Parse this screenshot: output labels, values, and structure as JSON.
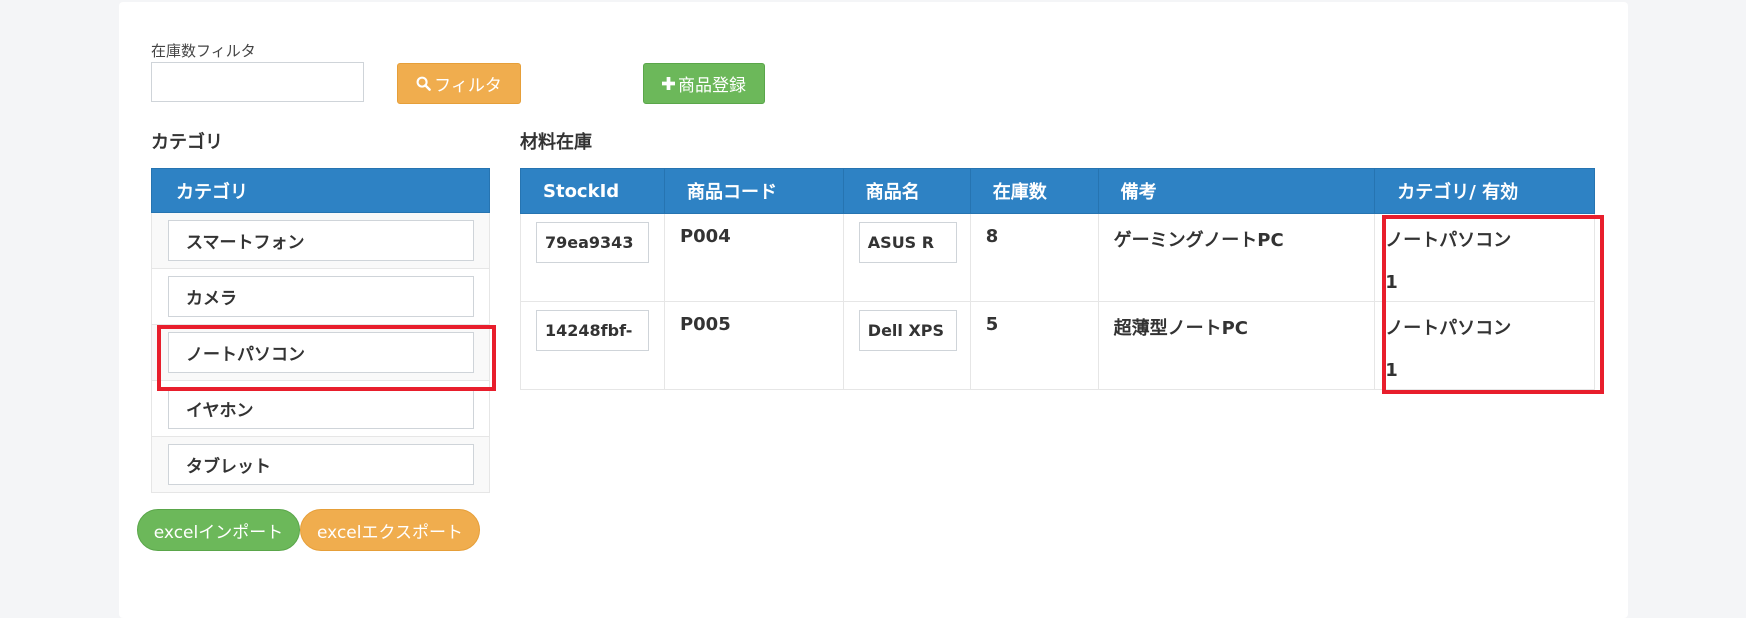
{
  "filter": {
    "label": "在庫数フィルタ",
    "value": "",
    "filter_button": "フィルタ",
    "register_button": "商品登録"
  },
  "category_section": {
    "title": "カテゴリ",
    "header": "カテゴリ",
    "items": [
      "スマートフォン",
      "カメラ",
      "ノートパソコン",
      "イヤホン",
      "タブレット"
    ]
  },
  "stock_section": {
    "title": "材料在庫",
    "columns": [
      "StockId",
      "商品コード",
      "商品名",
      "在庫数",
      "備考",
      "カテゴリ/ 有効"
    ],
    "rows": [
      {
        "stock_id": "79ea9343",
        "code": "P004",
        "name": "ASUS R",
        "qty": "8",
        "note": "ゲーミングノートPC",
        "category": "ノートパソコン",
        "active": "1"
      },
      {
        "stock_id": "14248fbf-",
        "code": "P005",
        "name": "Dell XPS",
        "qty": "5",
        "note": "超薄型ノートPC",
        "category": "ノートパソコン",
        "active": "1"
      }
    ]
  },
  "footer": {
    "import_button": "excelインポート",
    "export_button": "excelエクスポート"
  },
  "icons": {
    "filter_icon": "search-icon",
    "register_icon": "plus-icon"
  },
  "colors": {
    "header_blue": "#2e82c4",
    "orange": "#f0ad4e",
    "green": "#6cb85a",
    "highlight_red": "#e81e2c"
  }
}
